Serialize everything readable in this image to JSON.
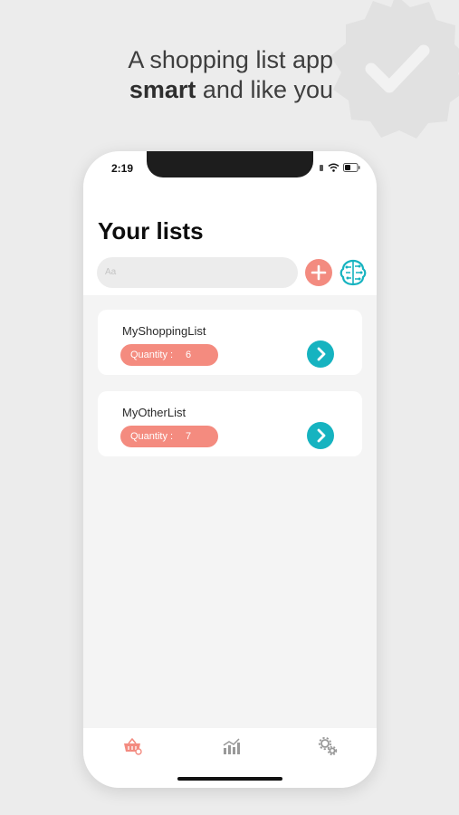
{
  "promo": {
    "line1": "A shopping list app",
    "line2_bold": "smart",
    "line2_rest": " and like you"
  },
  "status_bar": {
    "time": "2:19"
  },
  "screen": {
    "title": "Your lists",
    "search_placeholder": "Aa",
    "lists": [
      {
        "name": "MyShoppingList",
        "quantity_label": "Quantity :",
        "quantity": "6"
      },
      {
        "name": "MyOtherList",
        "quantity_label": "Quantity :",
        "quantity": "7"
      }
    ]
  },
  "tabbar": {
    "tabs": [
      {
        "icon": "basket-icon",
        "active": true
      },
      {
        "icon": "stats-chart-icon",
        "active": false
      },
      {
        "icon": "gears-icon",
        "active": false
      }
    ]
  },
  "colors": {
    "accent_coral": "#f48b7f",
    "accent_teal": "#16b3c0",
    "background": "#ececec"
  }
}
